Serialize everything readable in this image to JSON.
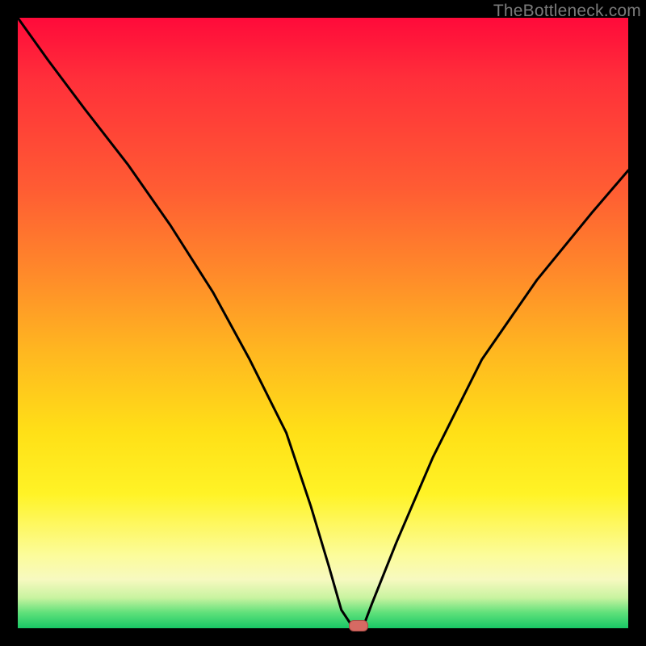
{
  "watermark": "TheBottleneck.com",
  "chart_data": {
    "type": "line",
    "title": "",
    "xlabel": "",
    "ylabel": "",
    "xlim": [
      0,
      100
    ],
    "ylim": [
      0,
      100
    ],
    "grid": false,
    "series": [
      {
        "name": "bottleneck-curve",
        "x": [
          0,
          5,
          11,
          18,
          25,
          32,
          38,
          44,
          48,
          51,
          53,
          55,
          56.5,
          58,
          62,
          68,
          76,
          85,
          94,
          100
        ],
        "values": [
          100,
          93,
          85,
          76,
          66,
          55,
          44,
          32,
          20,
          10,
          3,
          0,
          0,
          4,
          14,
          28,
          44,
          57,
          68,
          75
        ]
      }
    ],
    "marker": {
      "x": 55.8,
      "y": 0
    },
    "background_gradient": {
      "stops": [
        {
          "pos": 0,
          "color": "#ff0a3a"
        },
        {
          "pos": 0.45,
          "color": "#ff8a2a"
        },
        {
          "pos": 0.75,
          "color": "#fff326"
        },
        {
          "pos": 0.95,
          "color": "#c9f3a0"
        },
        {
          "pos": 1.0,
          "color": "#18c765"
        }
      ]
    }
  }
}
